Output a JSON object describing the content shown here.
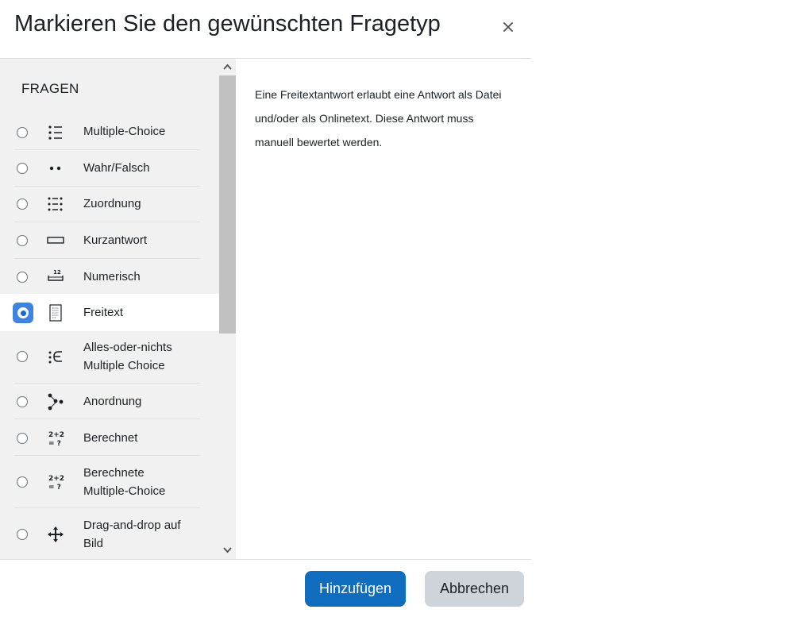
{
  "dialog": {
    "title": "Markieren Sie den gewünschten Fragetyp",
    "close_icon": "close-icon"
  },
  "options": {
    "heading": "FRAGEN",
    "items": [
      {
        "label": "Multiple-Choice",
        "icon": "multichoice-icon",
        "selected": false
      },
      {
        "label": "Wahr/Falsch",
        "icon": "truefalse-icon",
        "selected": false
      },
      {
        "label": "Zuordnung",
        "icon": "match-icon",
        "selected": false
      },
      {
        "label": "Kurzantwort",
        "icon": "shortanswer-icon",
        "selected": false
      },
      {
        "label": "Numerisch",
        "icon": "numerical-icon",
        "selected": false
      },
      {
        "label": "Freitext",
        "icon": "essay-icon",
        "selected": true
      },
      {
        "label_line1": "Alles-oder-nichts",
        "label_line2": "Multiple Choice",
        "icon": "multichoiceset-icon",
        "selected": false
      },
      {
        "label": "Anordnung",
        "icon": "ordering-icon",
        "selected": false
      },
      {
        "label": "Berechnet",
        "icon": "calculated-icon",
        "selected": false
      },
      {
        "label_line1": "Berechnete",
        "label_line2": "Multiple-Choice",
        "icon": "calculatedmulti-icon",
        "selected": false
      },
      {
        "label_line1": "Drag-and-drop auf",
        "label_line2": "Bild",
        "icon": "ddimageortext-icon",
        "selected": false
      }
    ]
  },
  "description": {
    "text": "Eine Freitextantwort erlaubt eine Antwort als Datei und/oder als Onlinetext. Diese Antwort muss manuell bewertet werden."
  },
  "footer": {
    "submit_label": "Hinzufügen",
    "cancel_label": "Abbrechen"
  },
  "colors": {
    "primary": "#0f6cbf",
    "secondary": "#ced4da",
    "selected_radio": "#3f83e0",
    "list_background": "#f1f1f1"
  }
}
